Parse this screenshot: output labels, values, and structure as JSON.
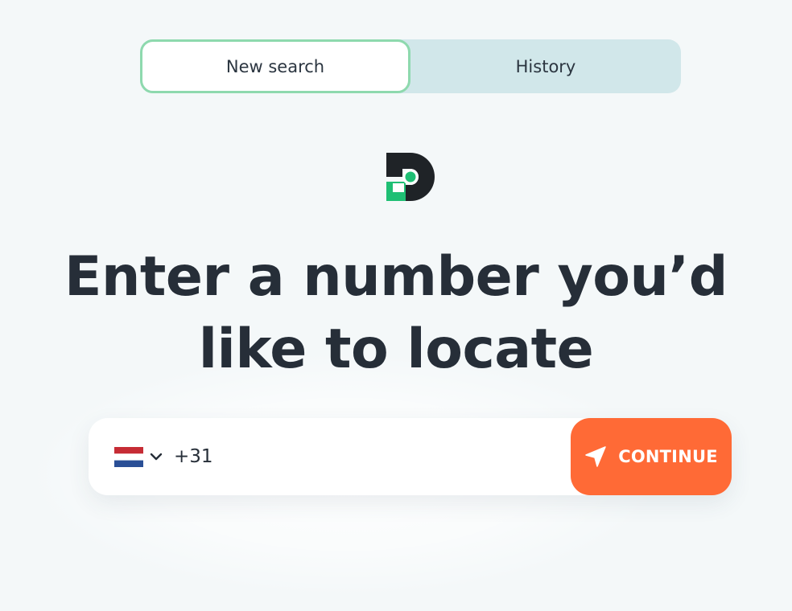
{
  "tabs": {
    "new_search": "New search",
    "history": "History",
    "active": "new_search"
  },
  "logo": {
    "icon": "location-pin-logo-icon"
  },
  "headline": {
    "line1": "Enter a number you’d",
    "line2": "like to locate"
  },
  "search": {
    "country_flag": "netherlands-flag-icon",
    "dropdown_icon": "chevron-down-icon",
    "phone_value": "+31",
    "continue_label": "CONTINUE",
    "continue_icon": "navigation-arrow-icon"
  },
  "colors": {
    "background": "#f4f8f9",
    "tab_track": "#d1e7ea",
    "tab_active_border": "#8ed9ae",
    "accent_green": "#1fbf74",
    "primary_button": "#ff6a36",
    "text_dark": "#262e38"
  }
}
